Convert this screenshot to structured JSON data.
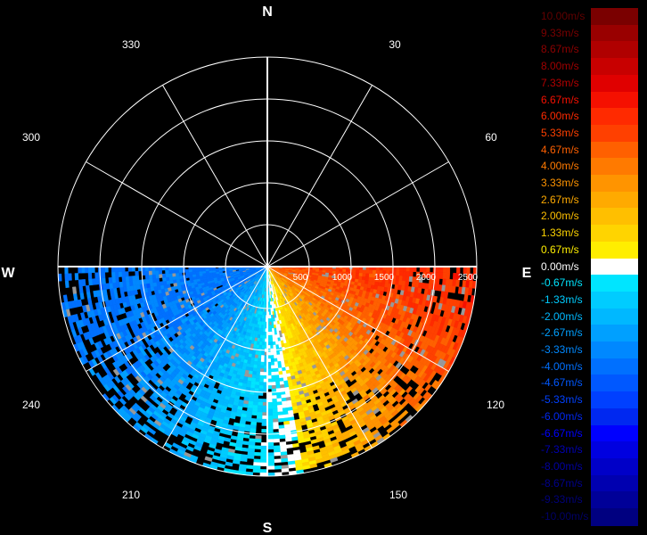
{
  "chart_data": {
    "type": "heatmap",
    "projection": "polar (PPI)",
    "compass": {
      "north": "N",
      "south": "S",
      "east": "E",
      "west": "W"
    },
    "azimuth_labels": [
      "30",
      "60",
      "120",
      "150",
      "210",
      "240",
      "300",
      "330"
    ],
    "range_labels": [
      "500",
      "1000",
      "1500",
      "2000",
      "2500"
    ],
    "range_max": 2500,
    "data_sector_azimuth": [
      90,
      270
    ],
    "grid": true,
    "legend_placement": "right",
    "unit": "m/s",
    "color_scale": [
      {
        "label": "10.00m/s",
        "value": 10.0,
        "color": "#7a0000"
      },
      {
        "label": "9.33m/s",
        "value": 9.33,
        "color": "#990000"
      },
      {
        "label": "8.67m/s",
        "value": 8.67,
        "color": "#b00000"
      },
      {
        "label": "8.00m/s",
        "value": 8.0,
        "color": "#c80000"
      },
      {
        "label": "7.33m/s",
        "value": 7.33,
        "color": "#e00000"
      },
      {
        "label": "6.67m/s",
        "value": 6.67,
        "color": "#f51000"
      },
      {
        "label": "6.00m/s",
        "value": 6.0,
        "color": "#ff2a00"
      },
      {
        "label": "5.33m/s",
        "value": 5.33,
        "color": "#ff4000"
      },
      {
        "label": "4.67m/s",
        "value": 4.67,
        "color": "#ff6000"
      },
      {
        "label": "4.00m/s",
        "value": 4.0,
        "color": "#ff7a00"
      },
      {
        "label": "3.33m/s",
        "value": 3.33,
        "color": "#ff9400"
      },
      {
        "label": "2.67m/s",
        "value": 2.67,
        "color": "#ffaa00"
      },
      {
        "label": "2.00m/s",
        "value": 2.0,
        "color": "#ffbf00"
      },
      {
        "label": "1.33m/s",
        "value": 1.33,
        "color": "#ffd400"
      },
      {
        "label": "0.67m/s",
        "value": 0.67,
        "color": "#ffee00"
      },
      {
        "label": "0.00m/s",
        "value": 0.0,
        "color": "#ffffff"
      },
      {
        "label": "-0.67m/s",
        "value": -0.67,
        "color": "#00e5ff"
      },
      {
        "label": "-1.33m/s",
        "value": -1.33,
        "color": "#00ccff"
      },
      {
        "label": "-2.00m/s",
        "value": -2.0,
        "color": "#00b8ff"
      },
      {
        "label": "-2.67m/s",
        "value": -2.67,
        "color": "#00a0ff"
      },
      {
        "label": "-3.33m/s",
        "value": -3.33,
        "color": "#0088ff"
      },
      {
        "label": "-4.00m/s",
        "value": -4.0,
        "color": "#0070ff"
      },
      {
        "label": "-4.67m/s",
        "value": -4.67,
        "color": "#0058ff"
      },
      {
        "label": "-5.33m/s",
        "value": -5.33,
        "color": "#0040ff"
      },
      {
        "label": "-6.00m/s",
        "value": -6.0,
        "color": "#0028f0"
      },
      {
        "label": "-6.67m/s",
        "value": -6.67,
        "color": "#0000ff"
      },
      {
        "label": "-7.33m/s",
        "value": -7.33,
        "color": "#0000e0"
      },
      {
        "label": "-8.00m/s",
        "value": -8.0,
        "color": "#0000c8"
      },
      {
        "label": "-8.67m/s",
        "value": -8.67,
        "color": "#0000b0"
      },
      {
        "label": "-9.33m/s",
        "value": -9.33,
        "color": "#000098"
      },
      {
        "label": "-10.00m/s",
        "value": -10.0,
        "color": "#000080"
      }
    ]
  }
}
